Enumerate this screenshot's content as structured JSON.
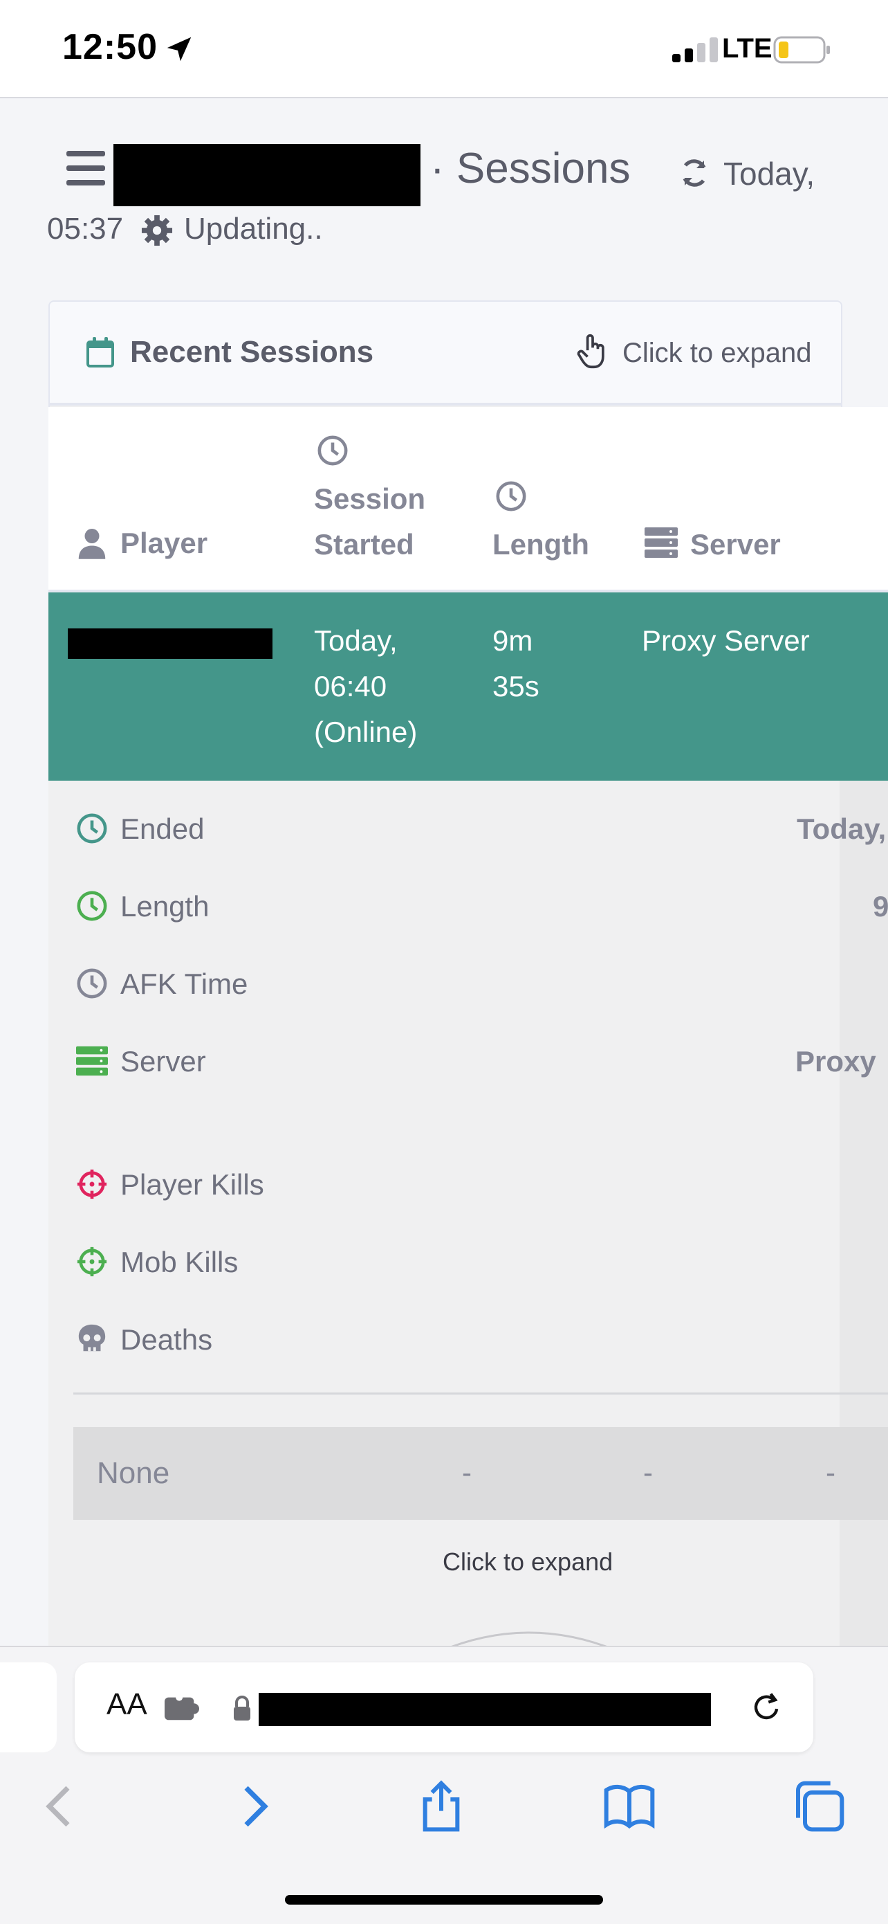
{
  "status_bar": {
    "time": "12:50",
    "network": "LTE"
  },
  "header": {
    "title": "· Sessions",
    "updated_day": "Today,",
    "updated_time": "05:37",
    "status": "Updating.."
  },
  "card": {
    "title": "Recent Sessions",
    "expand_label": "Click to expand"
  },
  "table": {
    "headers": {
      "player": "Player",
      "started_line1": "Session",
      "started_line2": "Started",
      "length": "Length",
      "server": "Server"
    },
    "row": {
      "started_line1": "Today,",
      "started_line2": "06:40",
      "started_line3": "(Online)",
      "length_line1": "9m",
      "length_line2": "35s",
      "server": "Proxy Server"
    }
  },
  "details": {
    "ended_label": "Ended",
    "ended_value": "Today,",
    "length_label": "Length",
    "length_value": "9",
    "afk_label": "AFK Time",
    "server_label": "Server",
    "server_value": "Proxy",
    "player_kills_label": "Player Kills",
    "mob_kills_label": "Mob Kills",
    "deaths_label": "Deaths"
  },
  "sub_table_row": {
    "name": "None",
    "col2": "-",
    "col3": "-",
    "col4": "-"
  },
  "bottom_expand_label": "Click to expand",
  "safari": {
    "text_size_label": "AA"
  },
  "colors": {
    "accent_teal": "#44968a",
    "icon_green": "#4caf50",
    "icon_red": "#e0245e",
    "icon_blue": "#2f7fe0"
  }
}
